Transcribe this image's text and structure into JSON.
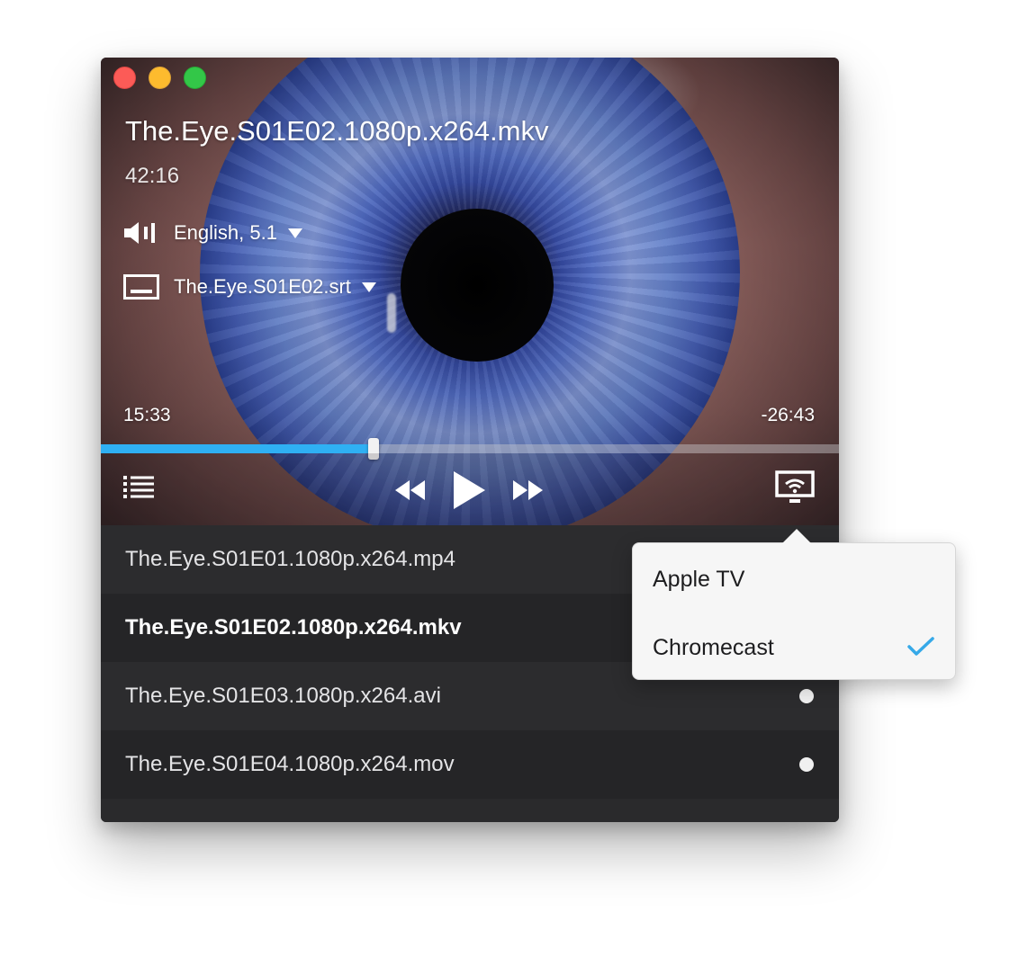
{
  "player": {
    "title": "The.Eye.S01E02.1080p.x264.mkv",
    "duration": "42:16",
    "audio_track": "English, 5.1",
    "subtitle_track": "The.Eye.S01E02.srt",
    "elapsed": "15:33",
    "remaining": "-26:43",
    "progress_fraction": 0.369,
    "accent_color": "#2fb0f3"
  },
  "playlist": {
    "items": [
      {
        "label": "The.Eye.S01E01.1080p.x264.mp4"
      },
      {
        "label": "The.Eye.S01E02.1080p.x264.mkv"
      },
      {
        "label": "The.Eye.S01E03.1080p.x264.avi"
      },
      {
        "label": "The.Eye.S01E04.1080p.x264.mov"
      }
    ]
  },
  "cast_menu": {
    "items": [
      {
        "label": "Apple TV"
      },
      {
        "label": "Chromecast"
      }
    ],
    "selected": "Chromecast"
  },
  "icons": {
    "close": "close-traffic-light",
    "minimize": "minimize-traffic-light",
    "zoom": "zoom-traffic-light",
    "audio": "speaker-icon",
    "subtitles": "subtitles-icon",
    "playlist": "list-icon",
    "rewind": "rewind-icon",
    "play": "play-icon",
    "forward": "fast-forward-icon",
    "cast": "cast-icon",
    "check": "checkmark-icon"
  }
}
